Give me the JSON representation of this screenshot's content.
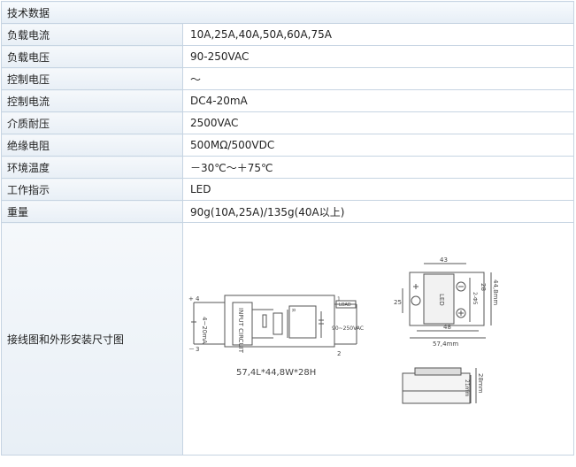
{
  "header": {
    "title": "技术数据"
  },
  "rows": [
    {
      "label": "负载电流",
      "value": "10A,25A,40A,50A,60A,75A"
    },
    {
      "label": "负载电压",
      "value": "90-250VAC"
    },
    {
      "label": "控制电压",
      "value": "～"
    },
    {
      "label": "控制电流",
      "value": "DC4-20mA"
    },
    {
      "label": "介质耐压",
      "value": "2500VAC"
    },
    {
      "label": "绝缘电阻",
      "value": "500MΩ/500VDC"
    },
    {
      "label": "环境温度",
      "value": "－30℃～＋75℃"
    },
    {
      "label": "工作指示",
      "value": "LED"
    },
    {
      "label": "重量",
      "value": "90g(10A,25A)/135g(40A以上)"
    }
  ],
  "diagram": {
    "label": "接线图和外形安装尺寸图",
    "terminal_4": "4",
    "terminal_3": "3",
    "terminal_1": "1",
    "terminal_2": "2",
    "plus": "+",
    "minus": "－",
    "input_current": "4~20mA",
    "input_circuit": "INPUT CIRCUIT",
    "circuit_small": "R",
    "load": "LOAD",
    "load_voltage": "90~250VAC",
    "dimensions_caption": "57,4L*44,8W*28H",
    "dim_43": "43",
    "dim_48": "48",
    "dim_57": "57,4mm",
    "dim_44": "44,8mm",
    "dim_28": "28",
    "dim_25": "25",
    "dim_hole": "2-Φ5",
    "dim_28mm": "28mm",
    "dim_21": "21mm",
    "led_text": "LED"
  }
}
